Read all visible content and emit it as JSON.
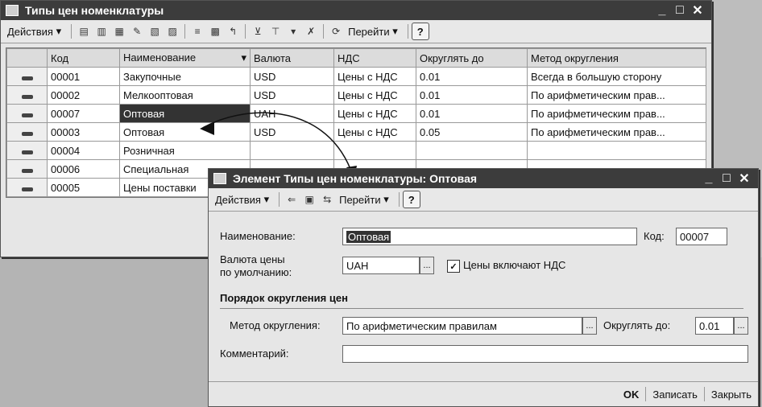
{
  "main_window": {
    "title": "Типы цен номенклатуры",
    "toolbar": {
      "actions_label": "Действия",
      "goto_label": "Перейти",
      "help_label": "?"
    },
    "columns": [
      "Код",
      "Наименование",
      "Валюта",
      "НДС",
      "Округлять до",
      "Метод округления"
    ],
    "rows": [
      {
        "code": "00001",
        "name": "Закупочные",
        "currency": "USD",
        "vat": "Цены с НДС",
        "round": "0.01",
        "method": "Всегда в большую сторону"
      },
      {
        "code": "00002",
        "name": "Мелкооптовая",
        "currency": "USD",
        "vat": "Цены с НДС",
        "round": "0.01",
        "method": "По арифметическим прав..."
      },
      {
        "code": "00007",
        "name": "Оптовая",
        "currency": "UAH",
        "vat": "Цены с НДС",
        "round": "0.01",
        "method": "По арифметическим прав..."
      },
      {
        "code": "00003",
        "name": "Оптовая",
        "currency": "USD",
        "vat": "Цены с НДС",
        "round": "0.05",
        "method": "По арифметическим прав..."
      },
      {
        "code": "00004",
        "name": "Розничная",
        "currency": "",
        "vat": "",
        "round": "",
        "method": ""
      },
      {
        "code": "00006",
        "name": "Специальная",
        "currency": "",
        "vat": "",
        "round": "",
        "method": ""
      },
      {
        "code": "00005",
        "name": "Цены поставки",
        "currency": "",
        "vat": "",
        "round": "",
        "method": ""
      }
    ]
  },
  "dialog": {
    "title": "Элемент Типы цен номенклатуры: Оптовая",
    "toolbar": {
      "actions_label": "Действия",
      "goto_label": "Перейти",
      "help_label": "?"
    },
    "name_label": "Наименование:",
    "name_value": "Оптовая",
    "code_label": "Код:",
    "code_value": "00007",
    "currency_label_1": "Валюта цены",
    "currency_label_2": "по умолчанию:",
    "currency_value": "UAH",
    "vat_checkbox_label": "Цены включают НДС",
    "vat_checked": true,
    "section_title": "Порядок округления цен",
    "method_label": "Метод округления:",
    "method_value": "По арифметическим правилам",
    "round_label": "Округлять до:",
    "round_value": "0.01",
    "comment_label": "Комментарий:",
    "comment_value": "",
    "ok_label": "OK",
    "save_label": "Записать",
    "close_label": "Закрыть"
  }
}
